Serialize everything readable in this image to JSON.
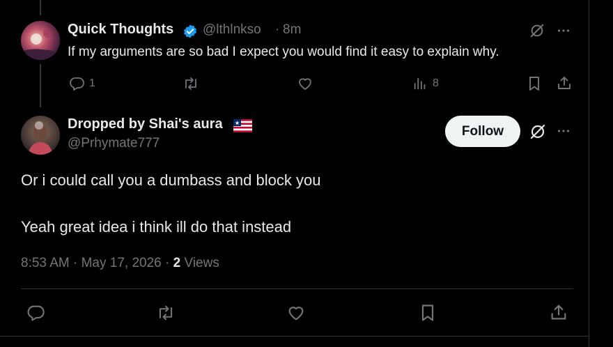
{
  "tweet1": {
    "name": "Quick Thoughts",
    "handle": "@lthlnkso",
    "separator": "·",
    "time": "8m",
    "text": "If my arguments are so bad I expect you would find it easy to explain why.",
    "reply_count": "1",
    "view_count": "8",
    "badge_icon": "verified-badge-icon"
  },
  "tweet2": {
    "name": "Dropped by Shai's aura",
    "flag_icon": "liberia-flag-icon",
    "handle": "@Prhymate777",
    "follow_label": "Follow",
    "line1": "Or i could call you a dumbass and block you",
    "line2": "Yeah great idea i think ill do that instead",
    "time": "8:53 AM",
    "date": "May 17, 2026",
    "views_count": "2",
    "views_label": "Views"
  },
  "colors": {
    "background": "#000000",
    "text": "#e7e9ea",
    "muted": "#71767b",
    "verified": "#1d9bf0",
    "follow_bg": "#eff3f4",
    "divider": "#2f3336"
  }
}
